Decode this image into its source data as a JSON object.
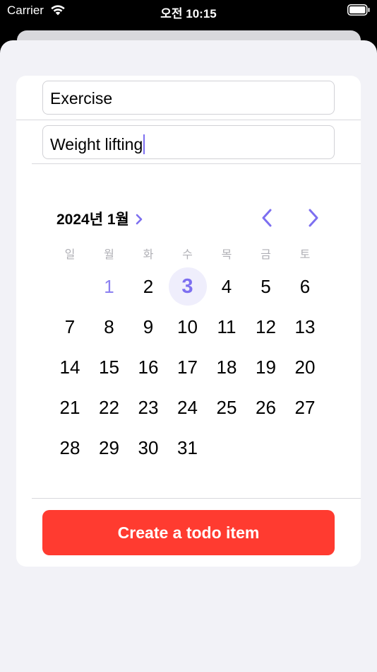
{
  "status_bar": {
    "carrier": "Carrier",
    "time": "오전 10:15"
  },
  "form": {
    "title_value": "Exercise",
    "notes_value": "Weight lifting",
    "create_button_label": "Create a todo item"
  },
  "calendar": {
    "month_label": "2024년 1월",
    "weekdays": [
      "일",
      "월",
      "화",
      "수",
      "목",
      "금",
      "토"
    ],
    "start_offset": 1,
    "days_in_month": 31,
    "today": 1,
    "selected": 3,
    "accent_color": "#7d6ff0"
  },
  "button_color": "#ff3b30"
}
